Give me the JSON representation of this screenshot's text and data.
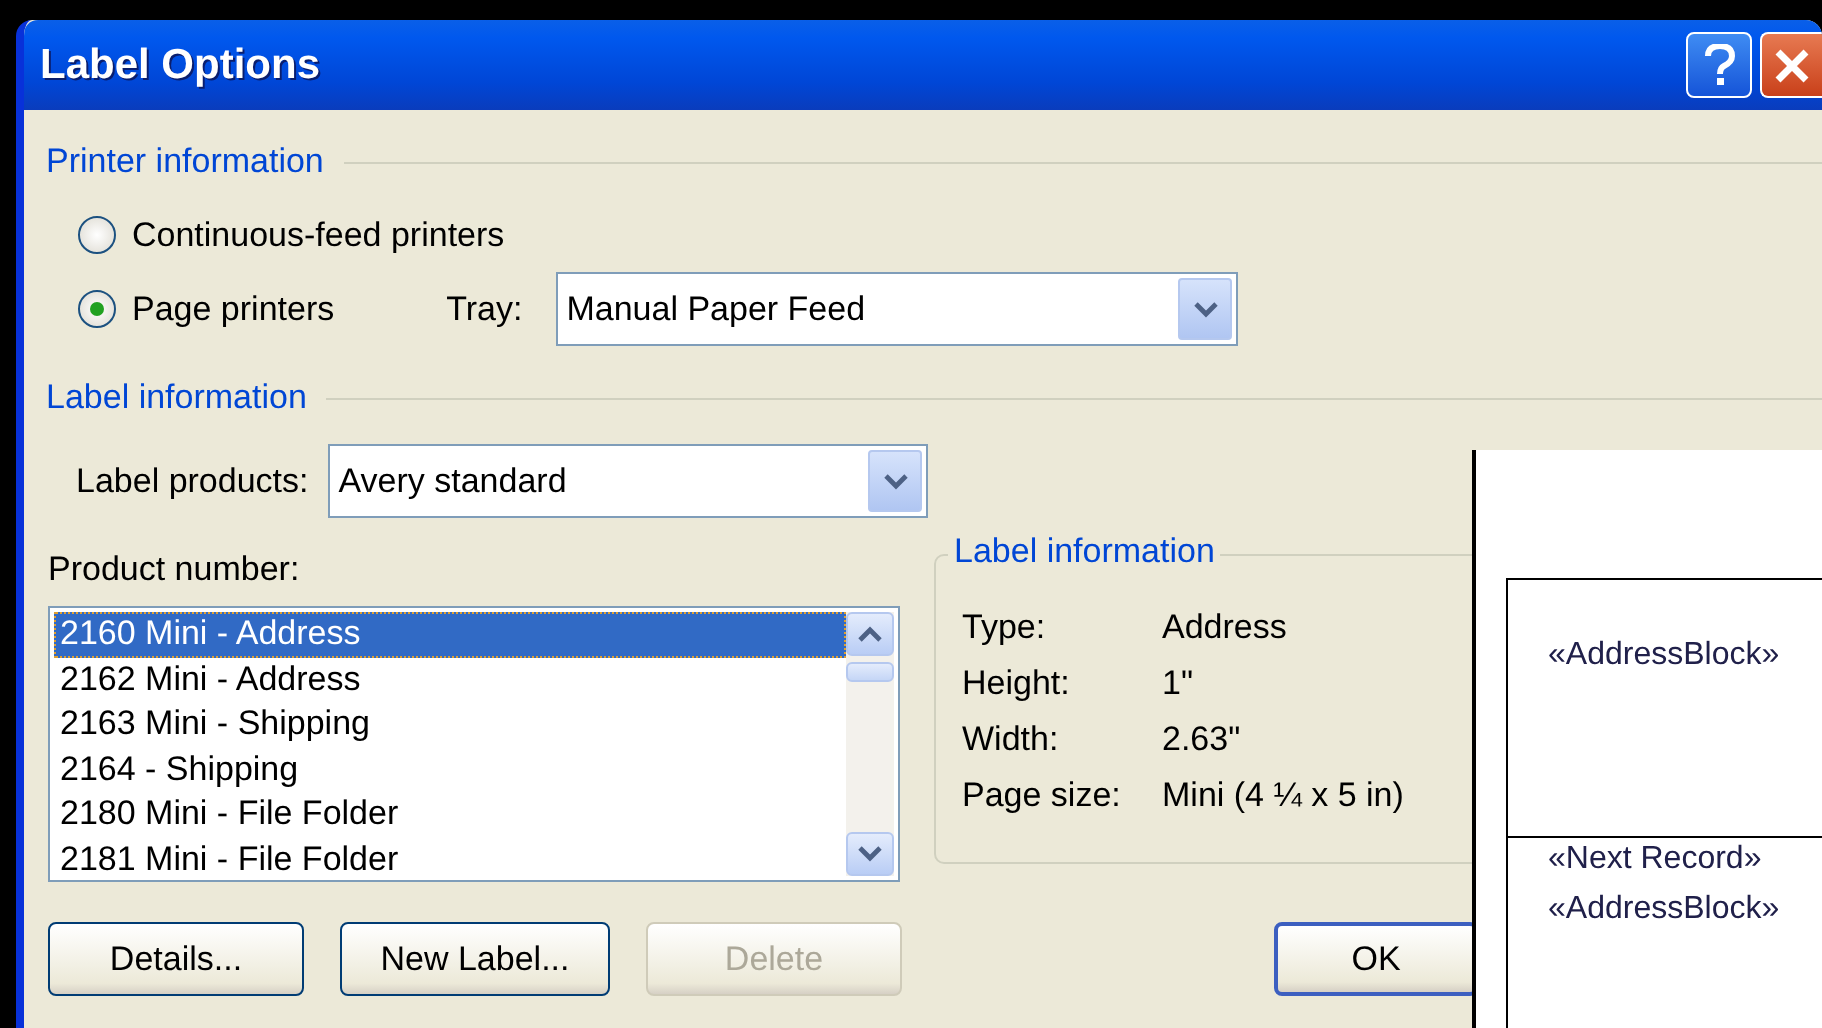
{
  "window": {
    "title": "Label Options"
  },
  "printer_information": {
    "heading": "Printer information",
    "options": [
      {
        "label": "Continuous-feed printers",
        "selected": false
      },
      {
        "label": "Page printers",
        "selected": true
      }
    ],
    "tray": {
      "label": "Tray:",
      "value": "Manual Paper Feed"
    }
  },
  "label_information": {
    "heading": "Label information",
    "label_products": {
      "label": "Label products:",
      "value": "Avery standard"
    },
    "product_number": {
      "label": "Product number:",
      "items": [
        {
          "label": "2160 Mini - Address",
          "selected": true
        },
        {
          "label": "2162 Mini - Address",
          "selected": false
        },
        {
          "label": "2163 Mini - Shipping",
          "selected": false
        },
        {
          "label": "2164 - Shipping",
          "selected": false
        },
        {
          "label": "2180 Mini - File Folder",
          "selected": false
        },
        {
          "label": "2181 Mini - File Folder",
          "selected": false
        }
      ]
    },
    "details": {
      "heading": "Label information",
      "rows": [
        {
          "name": "Type:",
          "value": "Address"
        },
        {
          "name": "Height:",
          "value": "1\""
        },
        {
          "name": "Width:",
          "value": "2.63\""
        },
        {
          "name": "Page size:",
          "value": "Mini (4 ¼ x 5 in)"
        }
      ]
    }
  },
  "buttons": [
    {
      "label": "Details...",
      "disabled": false,
      "default": false
    },
    {
      "label": "New Label...",
      "disabled": false,
      "default": false
    },
    {
      "label": "Delete",
      "disabled": true,
      "default": false
    }
  ],
  "dialog_buttons": [
    {
      "label": "OK",
      "disabled": false,
      "default": true
    }
  ],
  "document": {
    "cells": [
      {
        "lines": [
          "«AddressBlock»"
        ]
      },
      {
        "lines": [
          "«Next Record»",
          "«AddressBlock»"
        ]
      }
    ]
  }
}
